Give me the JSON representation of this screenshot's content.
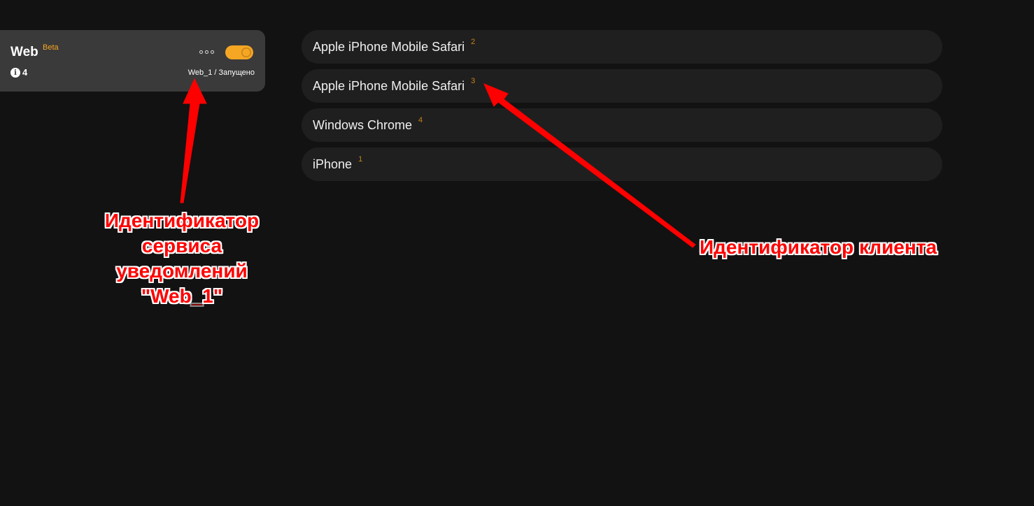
{
  "service": {
    "title": "Web",
    "badge": "Beta",
    "info_count": "4",
    "status": "Web_1 / Запущено",
    "toggle_on": true,
    "accent_color": "#f5a623"
  },
  "clients": [
    {
      "name": "Apple iPhone Mobile Safari",
      "id": "2"
    },
    {
      "name": "Apple iPhone Mobile Safari",
      "id": "3"
    },
    {
      "name": "Windows Chrome",
      "id": "4"
    },
    {
      "name": "iPhone",
      "id": "1"
    }
  ],
  "annotations": {
    "service_id_lines": [
      "Идентификатор",
      "сервиса",
      "уведомлений",
      "\"Web_1\""
    ],
    "client_id": "Идентификатор клиента",
    "color": "#ff0000"
  }
}
